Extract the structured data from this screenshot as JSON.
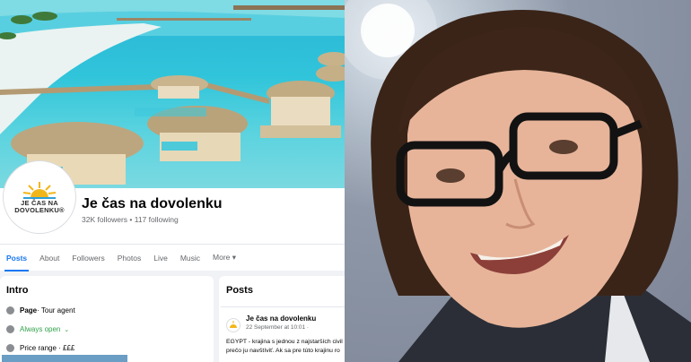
{
  "page": {
    "name": "Je čas na dovolenku",
    "stats": "32K followers • 117 following",
    "logo_line1": "JE ČAS NA",
    "logo_line2": "DOVOLENKU®"
  },
  "tabs": [
    "Posts",
    "About",
    "Followers",
    "Photos",
    "Live",
    "Music",
    "More ▾"
  ],
  "intro": {
    "title": "Intro",
    "page_label": "Page",
    "category": " · Tour agent",
    "hours": "Always open",
    "hours_chevron": "⌄",
    "price": "Price range · £££"
  },
  "posts": {
    "title": "Posts",
    "author": "Je čas na dovolenku",
    "date": "22 September at 10:01 · ",
    "line1": "EGYPT - krajina s jednou z najstarších civil",
    "line2": "prečo ju navštíviť. Ak sa pre túto krajinu ro"
  },
  "colors": {
    "accent": "#1877f2",
    "green": "#31a24c",
    "sea": "#30c4da"
  },
  "icons": {
    "page": "info-icon",
    "hours": "clock-icon",
    "price": "tag-icon",
    "more": "chevron-down-icon"
  }
}
